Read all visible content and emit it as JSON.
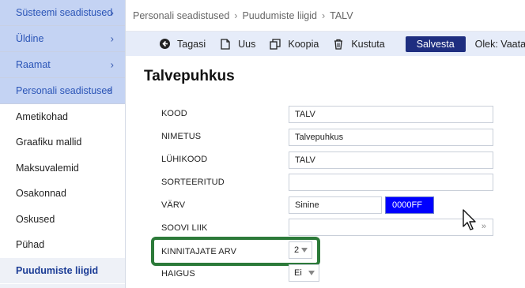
{
  "sidebar": {
    "sections": [
      {
        "label": "Süsteemi seadistused",
        "chevron": "›"
      },
      {
        "label": "Üldine",
        "chevron": "›"
      },
      {
        "label": "Raamat",
        "chevron": "›"
      },
      {
        "label": "Personali seadistused",
        "chevron": "⌄"
      }
    ],
    "items": [
      {
        "label": "Ametikohad"
      },
      {
        "label": "Graafiku mallid"
      },
      {
        "label": "Maksuvalemid"
      },
      {
        "label": "Osakonnad"
      },
      {
        "label": "Oskused"
      },
      {
        "label": "Pühad"
      },
      {
        "label": "Puudumiste liigid"
      }
    ]
  },
  "breadcrumb": [
    "Personali seadistused",
    "Puudumiste liigid",
    "TALV"
  ],
  "toolbar": {
    "back": "Tagasi",
    "new": "Uus",
    "copy": "Koopia",
    "delete": "Kustuta",
    "save": "Salvesta",
    "status": "Olek: Vaata"
  },
  "form": {
    "title": "Talvepuhkus",
    "labels": {
      "kood": "KOOD",
      "nimetus": "NIMETUS",
      "luhikood": "LÜHIKOOD",
      "sorteeritud": "SORTEERITUD",
      "varv": "VÄRV",
      "soovi_liik": "SOOVI LIIK",
      "kinnitajate_arv": "KINNITAJATE ARV",
      "haigus": "HAIGUS"
    },
    "values": {
      "kood": "TALV",
      "nimetus": "Talvepuhkus",
      "luhikood": "TALV",
      "sorteeritud": "",
      "varv_name": "Sinine",
      "varv_hex": "0000FF",
      "soovi_liik": "",
      "soovi_liik_arrow": "»",
      "kinnitajate_arv": "2",
      "haigus": "Ei"
    }
  },
  "colors": {
    "accent": "#1e2e80",
    "highlight": "#2c7a39",
    "swatch": "#0000ff"
  }
}
